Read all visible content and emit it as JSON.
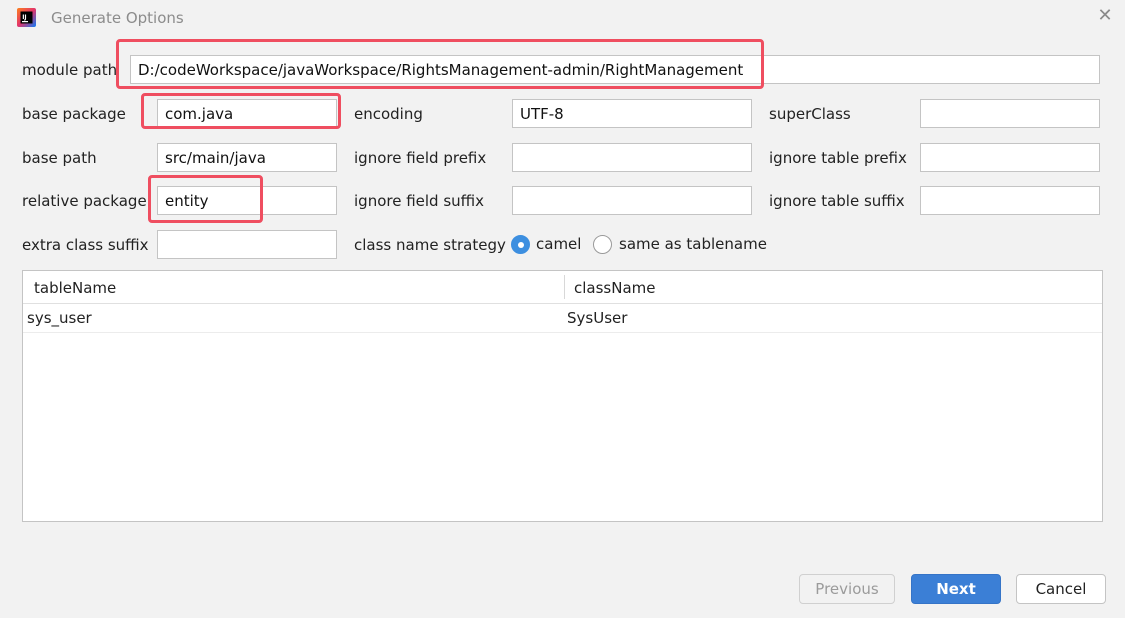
{
  "window": {
    "title": "Generate Options",
    "close_glyph": "✕"
  },
  "form": {
    "module_path": {
      "label": "module path",
      "value": "D:/codeWorkspace/javaWorkspace/RightsManagement-admin/RightManagement"
    },
    "base_package": {
      "label": "base package",
      "value": "com.java"
    },
    "encoding": {
      "label": "encoding",
      "value": "UTF-8"
    },
    "super_class": {
      "label": "superClass",
      "value": ""
    },
    "base_path": {
      "label": "base path",
      "value": "src/main/java"
    },
    "ignore_field_prefix": {
      "label": "ignore field prefix",
      "value": ""
    },
    "ignore_table_prefix": {
      "label": "ignore table prefix",
      "value": ""
    },
    "relative_package": {
      "label": "relative package",
      "value": "entity"
    },
    "ignore_field_suffix": {
      "label": "ignore field suffix",
      "value": ""
    },
    "ignore_table_suffix": {
      "label": "ignore table suffix",
      "value": ""
    },
    "extra_class_suffix": {
      "label": "extra class suffix",
      "value": ""
    },
    "class_name_strategy": {
      "label": "class name strategy",
      "options": [
        {
          "label": "camel",
          "selected": true
        },
        {
          "label": "same as tablename",
          "selected": false
        }
      ]
    }
  },
  "table": {
    "columns": [
      "tableName",
      "className"
    ],
    "rows": [
      [
        "sys_user",
        "SysUser"
      ]
    ]
  },
  "buttons": {
    "previous": "Previous",
    "next": "Next",
    "cancel": "Cancel"
  },
  "colors": {
    "highlight": "#ef4e60",
    "primary": "#3b7fd6",
    "radio_selected": "#3d8fe0"
  },
  "icons": {
    "app": "intellij-idea-icon",
    "close": "close-icon"
  }
}
